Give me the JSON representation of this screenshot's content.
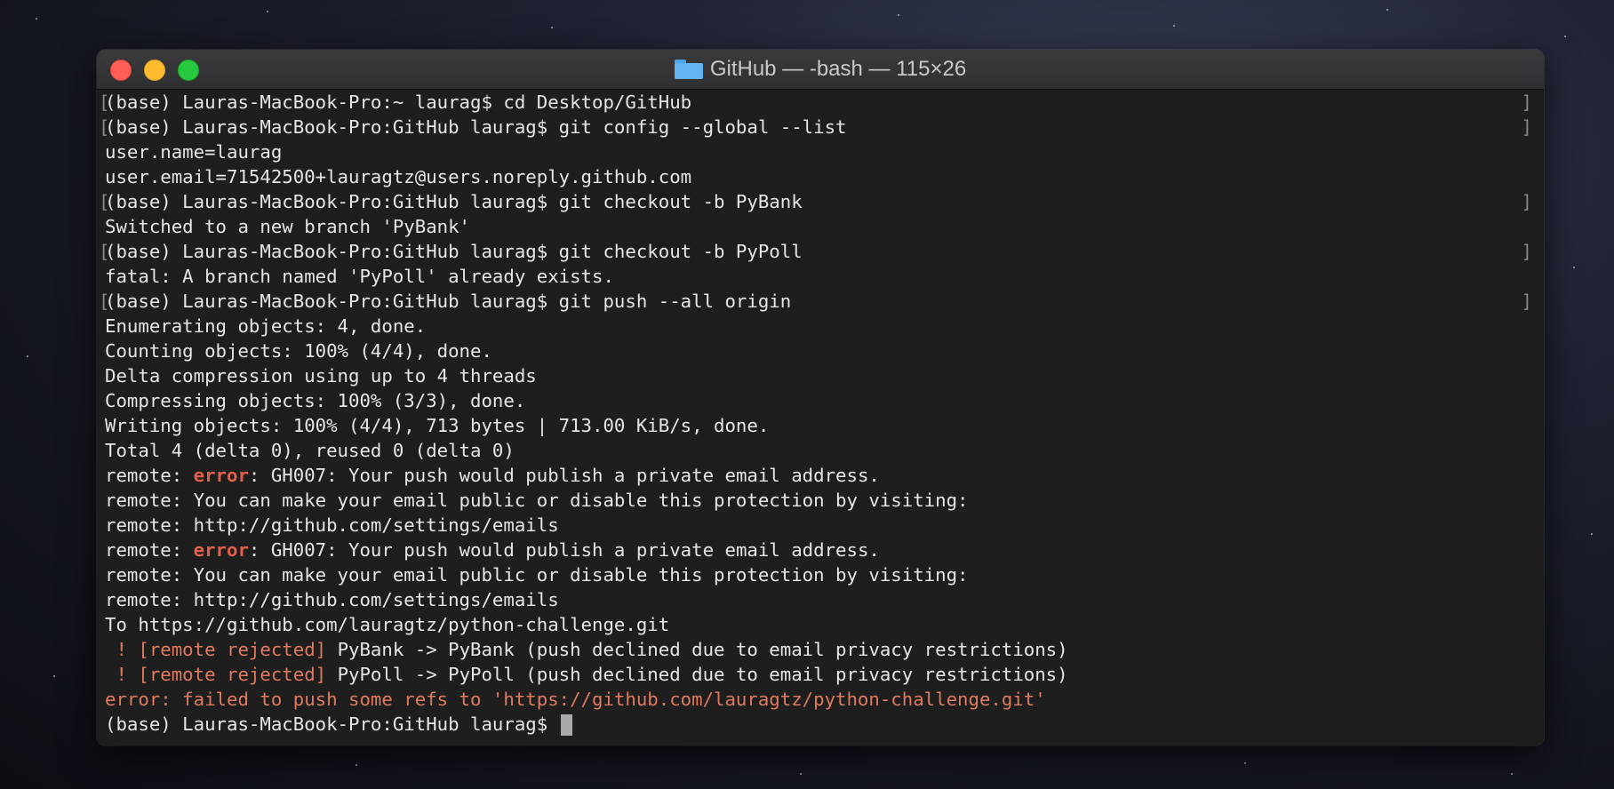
{
  "window": {
    "title": "GitHub — -bash — 115×26",
    "folder_icon": "folder-icon"
  },
  "colors": {
    "error_keyword": "#e35f4a",
    "rejected_text": "#e07a5f",
    "text": "#e6e6e6",
    "background": "#1e1e1e"
  },
  "terminal": {
    "l1": "(base) Lauras-MacBook-Pro:~ laurag$ cd Desktop/GitHub",
    "l2": "(base) Lauras-MacBook-Pro:GitHub laurag$ git config --global --list",
    "l3": "user.name=laurag",
    "l4": "user.email=71542500+lauragtz@users.noreply.github.com",
    "l5": "(base) Lauras-MacBook-Pro:GitHub laurag$ git checkout -b PyBank",
    "l6": "Switched to a new branch 'PyBank'",
    "l7": "(base) Lauras-MacBook-Pro:GitHub laurag$ git checkout -b PyPoll",
    "l8": "fatal: A branch named 'PyPoll' already exists.",
    "l9": "(base) Lauras-MacBook-Pro:GitHub laurag$ git push --all origin",
    "l10": "Enumerating objects: 4, done.",
    "l11": "Counting objects: 100% (4/4), done.",
    "l12": "Delta compression using up to 4 threads",
    "l13": "Compressing objects: 100% (3/3), done.",
    "l14": "Writing objects: 100% (4/4), 713 bytes | 713.00 KiB/s, done.",
    "l15": "Total 4 (delta 0), reused 0 (delta 0)",
    "remote_prefix": "remote: ",
    "error_word": "error",
    "gh007_msg": ": GH007: Your push would publish a private email address.",
    "l17": "remote: You can make your email public or disable this protection by visiting:",
    "l18": "remote: http://github.com/settings/emails",
    "l22": "To https://github.com/lauragtz/python-challenge.git",
    "rejected_label": " ! [remote rejected]",
    "l23_rest": " PyBank -> PyBank (push declined due to email privacy restrictions)",
    "l24_rest": " PyPoll -> PyPoll (push declined due to email privacy restrictions)",
    "l25": "error: failed to push some refs to 'https://github.com/lauragtz/python-challenge.git'",
    "l26": "(base) Lauras-MacBook-Pro:GitHub laurag$ "
  }
}
